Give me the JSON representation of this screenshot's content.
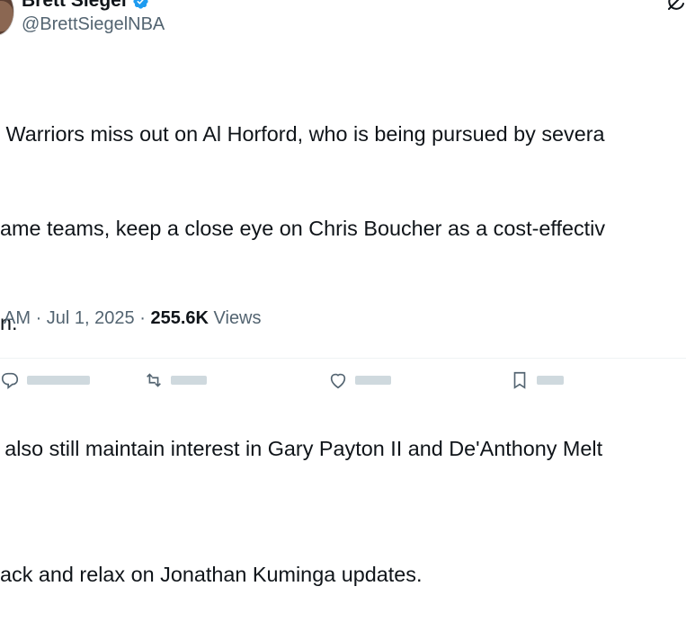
{
  "author": {
    "display_name": "Brett Siegel",
    "handle": "@BrettSiegelNBA",
    "verified_color": "#1d9bf0"
  },
  "tweet": {
    "paragraphs": [
      [
        "e Warriors miss out on Al Horford, who is being pursued by severa",
        "name teams, keep a close eye on Chris Boucher as a cost-effectiv",
        "on."
      ],
      [
        "s also still maintain interest in Gary Payton II and De'Anthony Melt"
      ],
      [
        "back and relax on Jonathan Kuminga updates."
      ]
    ]
  },
  "meta": {
    "time": "AM",
    "separator": "·",
    "date": "Jul 1, 2025",
    "views_count": "255.6K",
    "views_label": "Views"
  },
  "icons": {
    "verified": "verified-badge-icon",
    "grok": "grok-icon",
    "reply": "reply-icon",
    "retweet": "retweet-icon",
    "like": "like-icon",
    "bookmark": "bookmark-icon"
  },
  "colors": {
    "text_primary": "#0f1419",
    "text_secondary": "#536471",
    "divider": "#eff3f4",
    "accent": "#1d9bf0"
  }
}
